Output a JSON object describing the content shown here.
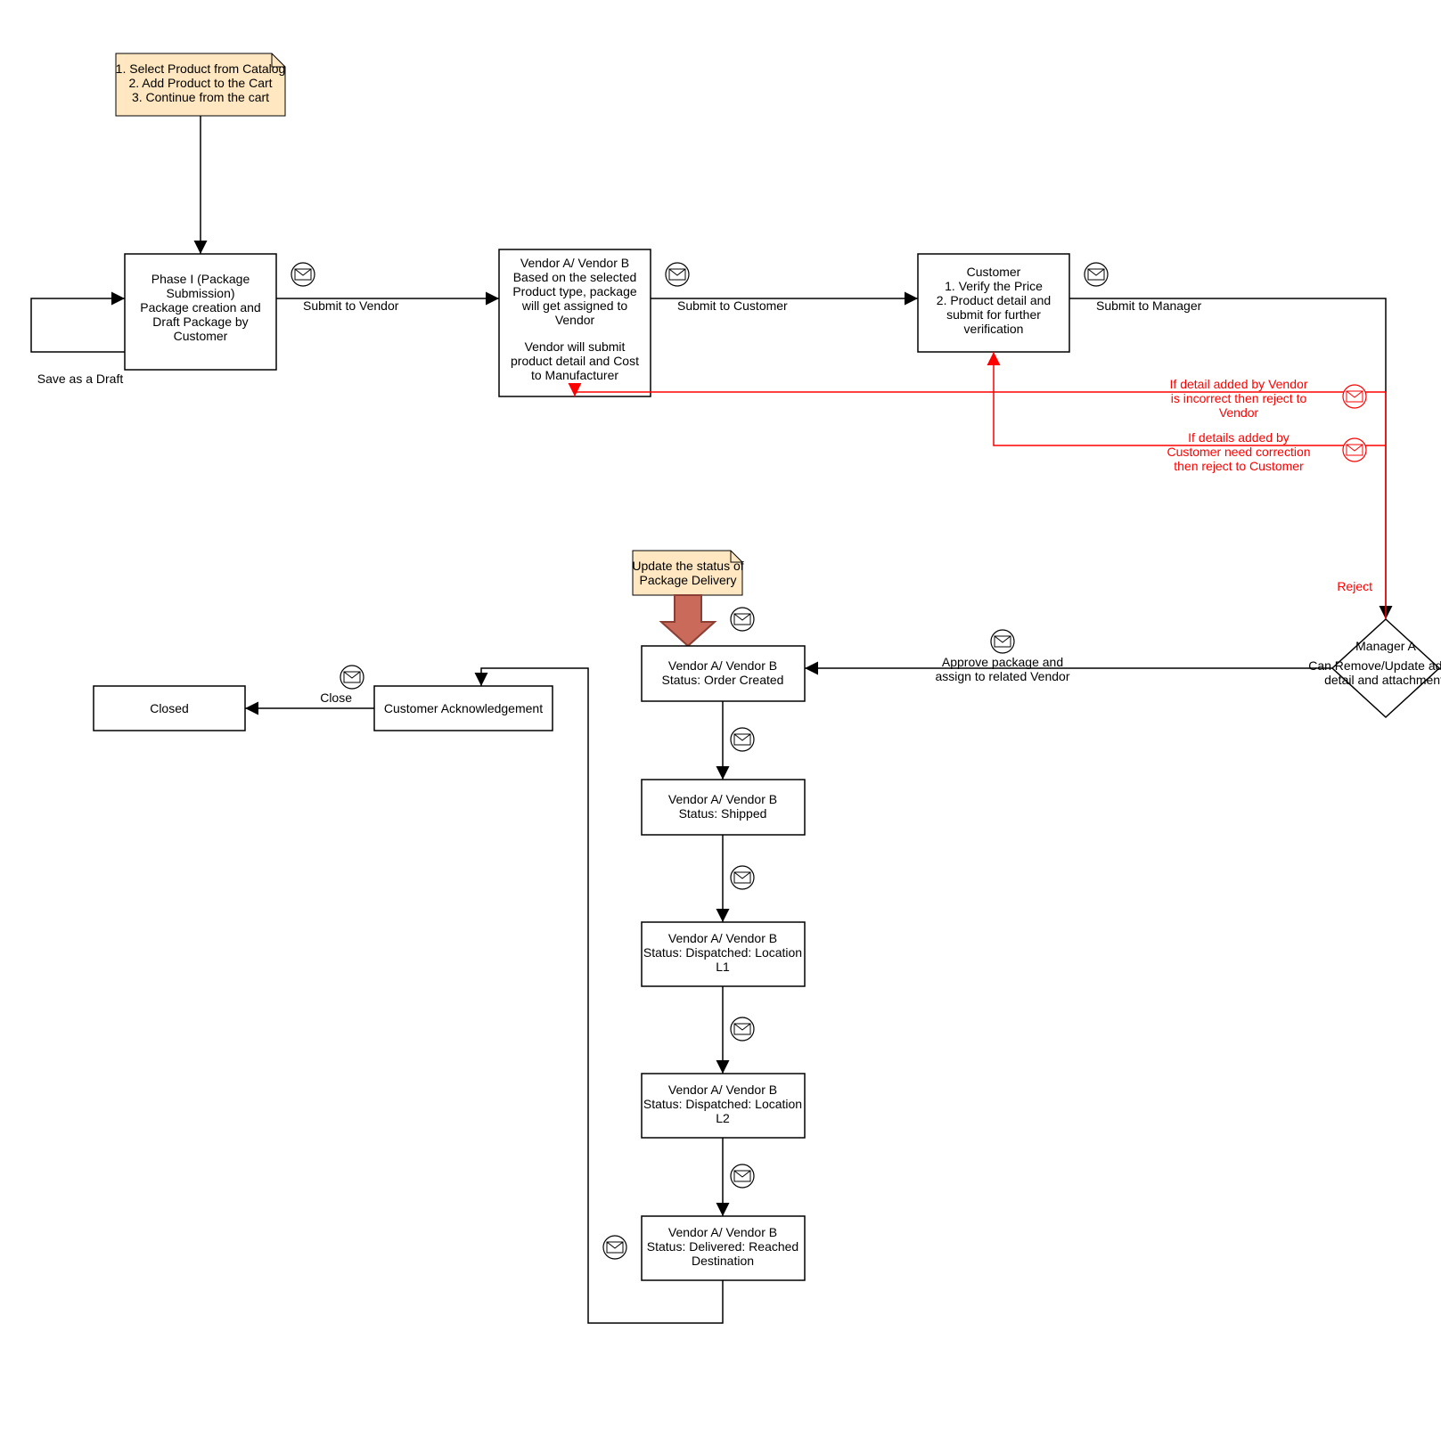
{
  "notes": {
    "catalog": {
      "l1": "1. Select Product from Catalog",
      "l2": "2. Add Product to the Cart",
      "l3": "3. Continue from the cart"
    },
    "delivery": {
      "l1": "Update the status of",
      "l2": "Package Delivery"
    }
  },
  "boxes": {
    "phase1": {
      "l1": "Phase I (Package",
      "l2": "Submission)",
      "l3": "Package creation and",
      "l4": "Draft Package by",
      "l5": "Customer"
    },
    "vendor": {
      "l1": "Vendor A/ Vendor B",
      "l2": "Based on the selected",
      "l3": "Product type, package",
      "l4": "will get assigned to",
      "l5": "Vendor",
      "l6": "Vendor will submit",
      "l7": "product detail and Cost",
      "l8": "to Manufacturer"
    },
    "customer": {
      "l1": "Customer",
      "l2": "1. Verify the Price",
      "l3": "2. Product detail and",
      "l4": "submit for further",
      "l5": "verification"
    },
    "manager": {
      "l1": "Manager A",
      "l2": "Can Remove/Update added",
      "l3": "detail and attachment."
    },
    "orderCreated": {
      "l1": "Vendor A/ Vendor B",
      "l2": "Status: Order Created"
    },
    "shipped": {
      "l1": "Vendor A/ Vendor B",
      "l2": "Status: Shipped"
    },
    "dispatchL1": {
      "l1": "Vendor A/ Vendor B",
      "l2": "Status: Dispatched: Location",
      "l3": "L1"
    },
    "dispatchL2": {
      "l1": "Vendor A/ Vendor B",
      "l2": "Status: Dispatched: Location",
      "l3": "L2"
    },
    "delivered": {
      "l1": "Vendor A/ Vendor B",
      "l2": "Status: Delivered: Reached",
      "l3": "Destination"
    },
    "ack": "Customer Acknowledgement",
    "closed": "Closed"
  },
  "edges": {
    "submitVendor": "Submit to Vendor",
    "submitCustomer": "Submit to Customer",
    "submitManager": "Submit to Manager",
    "saveDraft": "Save as a Draft",
    "close": "Close",
    "approve": {
      "l1": "Approve package and",
      "l2": "assign to related Vendor"
    },
    "reject": "Reject",
    "rejVendor": {
      "l1": "If detail added by Vendor",
      "l2": "is incorrect then reject to",
      "l3": "Vendor"
    },
    "rejCustomer": {
      "l1": "If details added by",
      "l2": "Customer need correction",
      "l3": "then reject to Customer"
    }
  }
}
